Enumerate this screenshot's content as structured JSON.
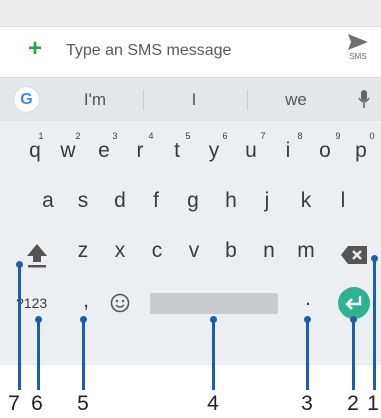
{
  "compose": {
    "placeholder": "Type an SMS message",
    "send_label": "SMS"
  },
  "suggestions": [
    "I'm",
    "I",
    "we"
  ],
  "rows": {
    "row1": [
      "q",
      "w",
      "e",
      "r",
      "t",
      "y",
      "u",
      "i",
      "o",
      "p"
    ],
    "row1_hints": [
      "1",
      "2",
      "3",
      "4",
      "5",
      "6",
      "7",
      "8",
      "9",
      "0"
    ],
    "row2": [
      "a",
      "s",
      "d",
      "f",
      "g",
      "h",
      "j",
      "k",
      "l"
    ],
    "row3": [
      "z",
      "x",
      "c",
      "v",
      "b",
      "n",
      "m"
    ]
  },
  "bottom_row": {
    "symbols_label": "?123",
    "comma": ",",
    "period": "."
  },
  "callouts": [
    "7",
    "6",
    "5",
    "4",
    "3",
    "2",
    "1"
  ],
  "colors": {
    "accent_green": "#2e9d4e",
    "enter_key": "#2eb38f",
    "callout_blue": "#1c5ea9"
  },
  "icons": [
    "plus-icon",
    "send-icon",
    "google-g-icon",
    "mic-icon",
    "shift-icon",
    "backspace-icon",
    "emoji-icon",
    "enter-icon"
  ]
}
